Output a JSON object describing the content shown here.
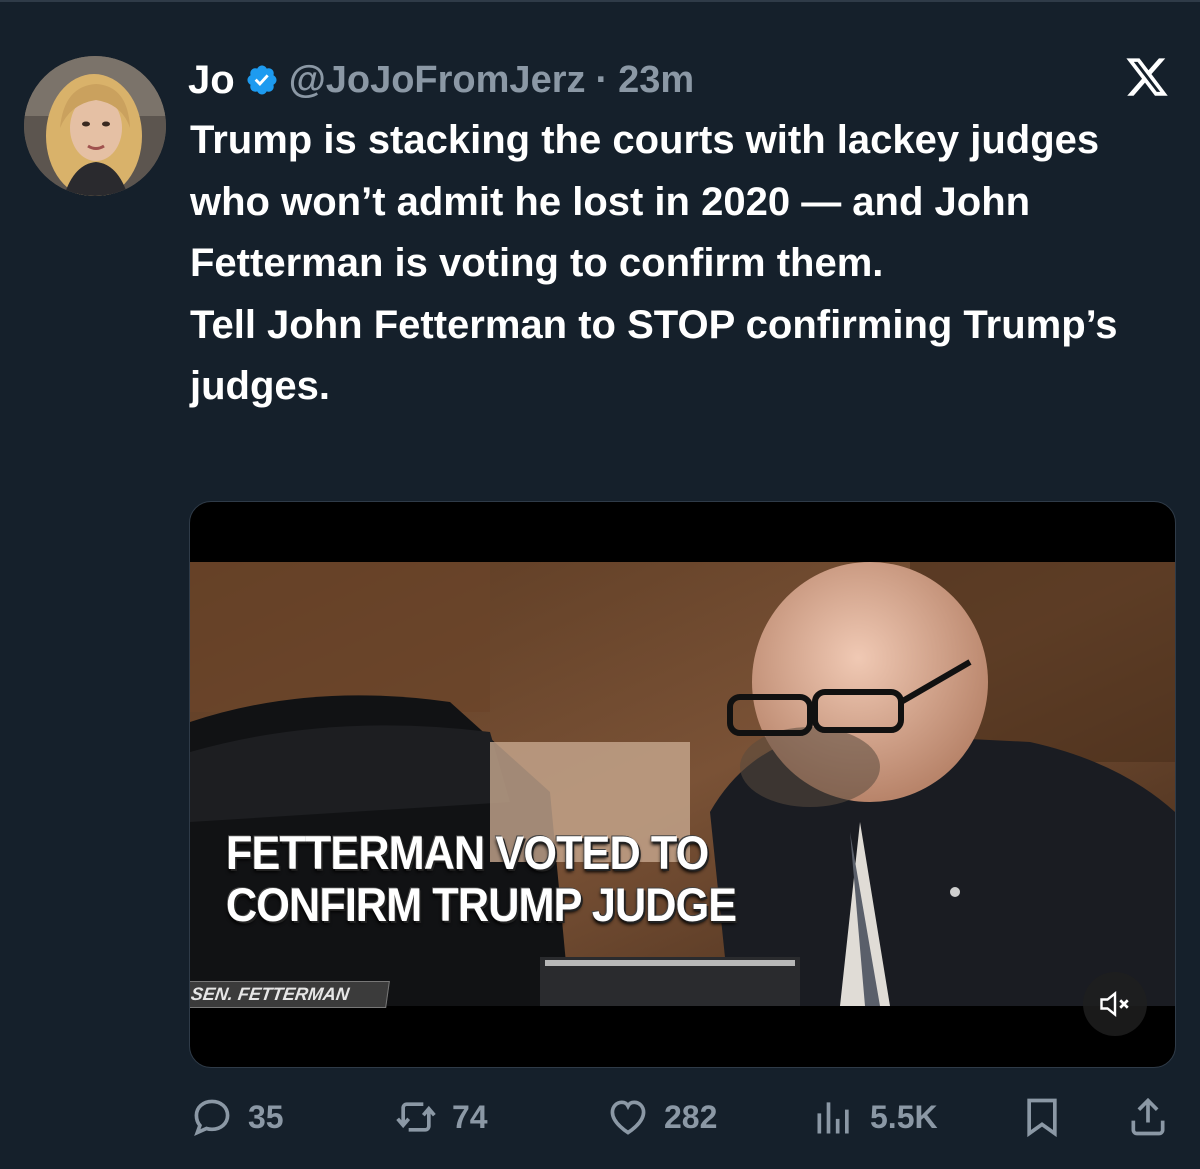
{
  "tweet": {
    "display_name": "Jo",
    "handle": "@JoJoFromJerz",
    "separator": "·",
    "time": "23m",
    "text_lines": [
      "Trump is stacking the courts with lackey judges who won’t admit he lost in 2020 — and John Fetterman is voting to confirm them.",
      "Tell John Fetterman to STOP confirming Trump’s judges."
    ]
  },
  "media": {
    "caption_line1": "FETTERMAN VOTED TO",
    "caption_line2": "CONFIRM TRUMP JUDGE",
    "nameplate": "SEN. FETTERMAN"
  },
  "actions": {
    "replies": "35",
    "reposts": "74",
    "likes": "282",
    "views": "5.5K"
  },
  "icons": [
    "verified-badge-icon",
    "x-logo-icon",
    "mute-icon",
    "reply-icon",
    "repost-icon",
    "like-icon",
    "views-icon",
    "bookmark-icon",
    "share-icon"
  ],
  "colors": {
    "background": "#15202b",
    "text": "#ffffff",
    "secondary_text": "#8b98a5",
    "verified_blue": "#1d9bf0"
  }
}
